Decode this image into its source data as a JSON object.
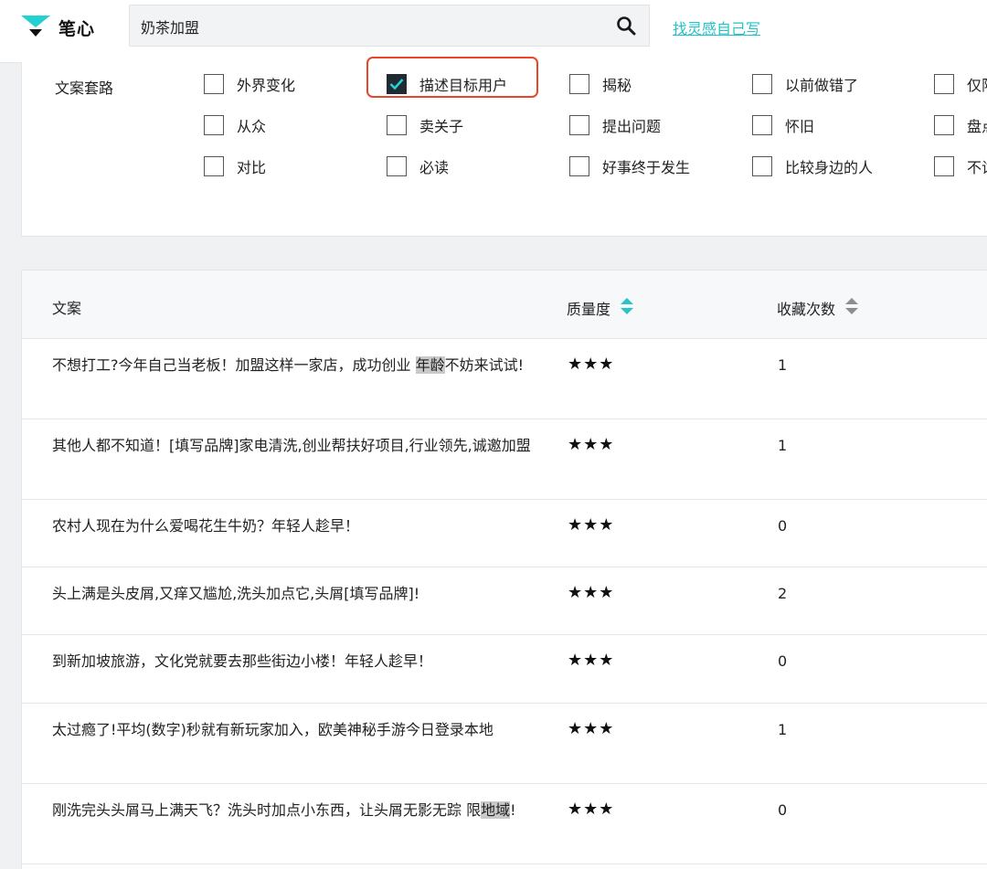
{
  "header": {
    "logo_text": "笔心",
    "search_value": "奶茶加盟",
    "write_link": "找灵感自己写"
  },
  "filter": {
    "label": "文案套路",
    "rows": [
      [
        {
          "label": "外界变化",
          "checked": false
        },
        {
          "label": "描述目标用户",
          "checked": true
        },
        {
          "label": "揭秘",
          "checked": false
        },
        {
          "label": "以前做错了",
          "checked": false
        },
        {
          "label": "仅限",
          "checked": false
        }
      ],
      [
        {
          "label": "从众",
          "checked": false
        },
        {
          "label": "卖关子",
          "checked": false
        },
        {
          "label": "提出问题",
          "checked": false
        },
        {
          "label": "怀旧",
          "checked": false
        },
        {
          "label": "盘点",
          "checked": false
        }
      ],
      [
        {
          "label": "对比",
          "checked": false
        },
        {
          "label": "必读",
          "checked": false
        },
        {
          "label": "好事终于发生",
          "checked": false
        },
        {
          "label": "比较身边的人",
          "checked": false
        },
        {
          "label": "不试",
          "checked": false
        }
      ]
    ]
  },
  "table": {
    "columns": {
      "text": "文案",
      "quality": "质量度",
      "favorites": "收藏次数"
    },
    "sort_active_color": "#23c3c8",
    "rows": [
      {
        "segments": [
          {
            "t": "不想打工?今年自己当老板！加盟这样一家店，成功创业 ",
            "m": false
          },
          {
            "t": "年龄",
            "m": true
          },
          {
            "t": "不妨来试试!",
            "m": false
          }
        ],
        "stars": "★★★",
        "count": "1"
      },
      {
        "segments": [
          {
            "t": "其他人都不知道！[填写品牌]家电清洗,创业帮扶好项目,行业领先,诚邀加盟",
            "m": false
          }
        ],
        "stars": "★★★",
        "count": "1"
      },
      {
        "segments": [
          {
            "t": "农村人现在为什么爱喝花生牛奶？年轻人趁早！",
            "m": false
          }
        ],
        "stars": "★★★",
        "count": "0"
      },
      {
        "segments": [
          {
            "t": "头上满是头皮屑,又痒又尴尬,洗头加点它,头屑[填写品牌]!",
            "m": false
          }
        ],
        "stars": "★★★",
        "count": "2"
      },
      {
        "segments": [
          {
            "t": "到新加坡旅游，文化党就要去那些街边小楼！年轻人趁早！",
            "m": false
          }
        ],
        "stars": "★★★",
        "count": "0"
      },
      {
        "segments": [
          {
            "t": "太过瘾了!平均(数字)秒就有新玩家加入，欧美神秘手游今日登录本地",
            "m": false
          }
        ],
        "stars": "★★★",
        "count": "1"
      },
      {
        "segments": [
          {
            "t": "刚洗完头头屑马上满天飞？洗头时加点小东西，让头屑无影无踪 限",
            "m": false
          },
          {
            "t": "地域",
            "m": true
          },
          {
            "t": "!",
            "m": false
          }
        ],
        "stars": "★★★",
        "count": "0"
      }
    ]
  }
}
